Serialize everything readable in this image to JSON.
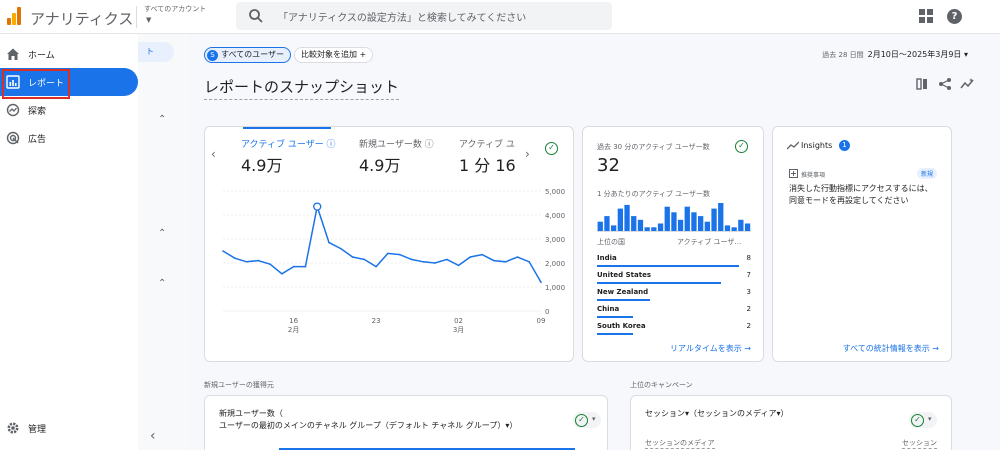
{
  "topbar": {
    "app_title": "アナリティクス",
    "account_label": "すべてのアカウント",
    "account_caret": "▼",
    "search_placeholder": "「アナリティクスの設定方法」と検索してみてください",
    "help_label": "?"
  },
  "leftnav": {
    "items": [
      {
        "label": "ホーム",
        "icon": "home-icon"
      },
      {
        "label": "レポート",
        "icon": "report-icon"
      },
      {
        "label": "探索",
        "icon": "explore-icon"
      },
      {
        "label": "広告",
        "icon": "advertising-icon"
      }
    ],
    "admin_label": "管理",
    "collapse_label": "‹"
  },
  "subnav": {
    "pill_label": "ト"
  },
  "main": {
    "chips": {
      "users_label": "すべてのユーザー",
      "users_badge": "S",
      "compare_label": "比較対象を追加 +"
    },
    "date_prefix": "過去 28 日間",
    "date_range": "2月10日～2025年3月9日 ▾",
    "page_title": "レポートのスナップショット",
    "metrics": [
      {
        "label": "アクティブ ユーザー ⓘ",
        "value": "4.9万"
      },
      {
        "label": "新規ユーザー数 ⓘ",
        "value": "4.9万"
      },
      {
        "label": "アクティブ ユ",
        "value": "1 分 16 秒"
      }
    ],
    "realtime": {
      "title": "過去 30 分のアクティブ ユーザー数",
      "value": "32",
      "subtitle": "1 分あたりのアクティブ ユーザー数",
      "col_country": "上位の国",
      "col_users": "アクティブ ユーザ…",
      "rows": [
        {
          "country": "India",
          "count": "8",
          "frac": 1.0
        },
        {
          "country": "United States",
          "count": "7",
          "frac": 0.875
        },
        {
          "country": "New Zealand",
          "count": "3",
          "frac": 0.375
        },
        {
          "country": "China",
          "count": "2",
          "frac": 0.25
        },
        {
          "country": "South Korea",
          "count": "2",
          "frac": 0.25
        }
      ],
      "link": "リアルタイムを表示 →"
    },
    "insights": {
      "title": "Insights",
      "badge": "1",
      "rec_label": "推奨事項",
      "new_label": "新規",
      "body": "消失した行動指標にアクセスするには、同意モードを再設定してください",
      "link": "すべての統計情報を表示 →"
    },
    "bottom": {
      "left_section": "新規ユーザーの獲得元",
      "right_section": "上位のキャンペーン",
      "left_title_1": "新規ユーザー数（",
      "left_title_2": "ユーザーの最初のメインのチャネル グループ（デフォルト チャネル グループ）▾）",
      "right_title": "セッション▾（セッションのメディア▾）",
      "right_col_left": "セッションのメディア",
      "right_col_right": "セッション"
    }
  },
  "chart_data": {
    "type": "line",
    "x_ticks": [
      {
        "label": "16\n2月",
        "index": 6
      },
      {
        "label": "23",
        "index": 13
      },
      {
        "label": "02\n3月",
        "index": 20
      },
      {
        "label": "09",
        "index": 27
      }
    ],
    "x_tick_labels": [
      "16",
      "2月",
      "23",
      "02",
      "3月",
      "09"
    ],
    "y_ticks": [
      "5,000",
      "4,000",
      "3,000",
      "2,000",
      "1,000",
      "0"
    ],
    "ylim": [
      0,
      5000
    ],
    "series": [
      {
        "values": [
          2500,
          2200,
          2050,
          2100,
          1950,
          1550,
          1850,
          1850,
          4350,
          2850,
          2600,
          2250,
          2150,
          1850,
          2400,
          2350,
          2150,
          2050,
          2000,
          2150,
          1900,
          2250,
          2350,
          2100,
          2050,
          2250,
          2050,
          1200
        ],
        "peak_index": 8
      }
    ],
    "colors": {
      "line": "#1a73e8",
      "grid": "#e0e0e0"
    }
  },
  "realtime_bars": [
    5,
    8,
    3,
    12,
    14,
    8,
    6,
    2,
    2,
    4,
    13,
    10,
    6,
    13,
    10,
    8,
    5,
    12,
    15,
    3,
    2,
    6,
    4
  ]
}
